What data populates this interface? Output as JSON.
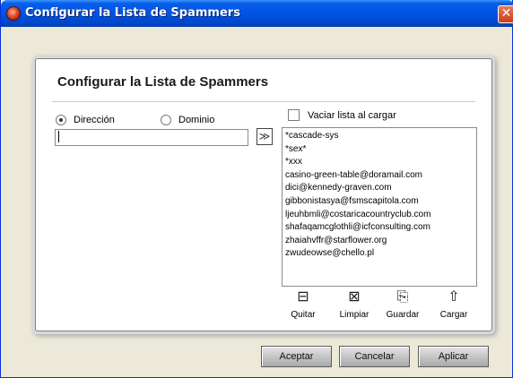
{
  "window": {
    "title": "Configurar la Lista de Spammers",
    "close_glyph": "✕"
  },
  "panel": {
    "heading": "Configurar la Lista de Spammers"
  },
  "mode": {
    "options": [
      "Dirección",
      "Dominio"
    ],
    "selected": "Dirección"
  },
  "address_input": {
    "value": ""
  },
  "add_button": {
    "glyph": "≫"
  },
  "clear_on_load": {
    "label": "Vaciar lista al cargar",
    "checked": false
  },
  "spam_list": {
    "items": [
      "*cascade-sys",
      "*sex*",
      "*xxx",
      "casino-green-table@doramail.com",
      "dici@kennedy-graven.com",
      "gibbonistasya@fsmscapitola.com",
      "ljeuhbmli@costaricacountryclub.com",
      "shafaqamcglothli@icfconsulting.com",
      "zhaiahvffr@starflower.org",
      "zwudeowse@chello.pl"
    ]
  },
  "tools": [
    {
      "label": "Quitar",
      "icon": "remove-icon",
      "glyph": "⊟"
    },
    {
      "label": "Limpiar",
      "icon": "clear-icon",
      "glyph": "⊠"
    },
    {
      "label": "Guardar",
      "icon": "save-icon",
      "glyph": "⎘"
    },
    {
      "label": "Cargar",
      "icon": "load-icon",
      "glyph": "⇧"
    }
  ],
  "buttons": {
    "accept": "Aceptar",
    "cancel": "Cancelar",
    "apply": "Aplicar"
  }
}
